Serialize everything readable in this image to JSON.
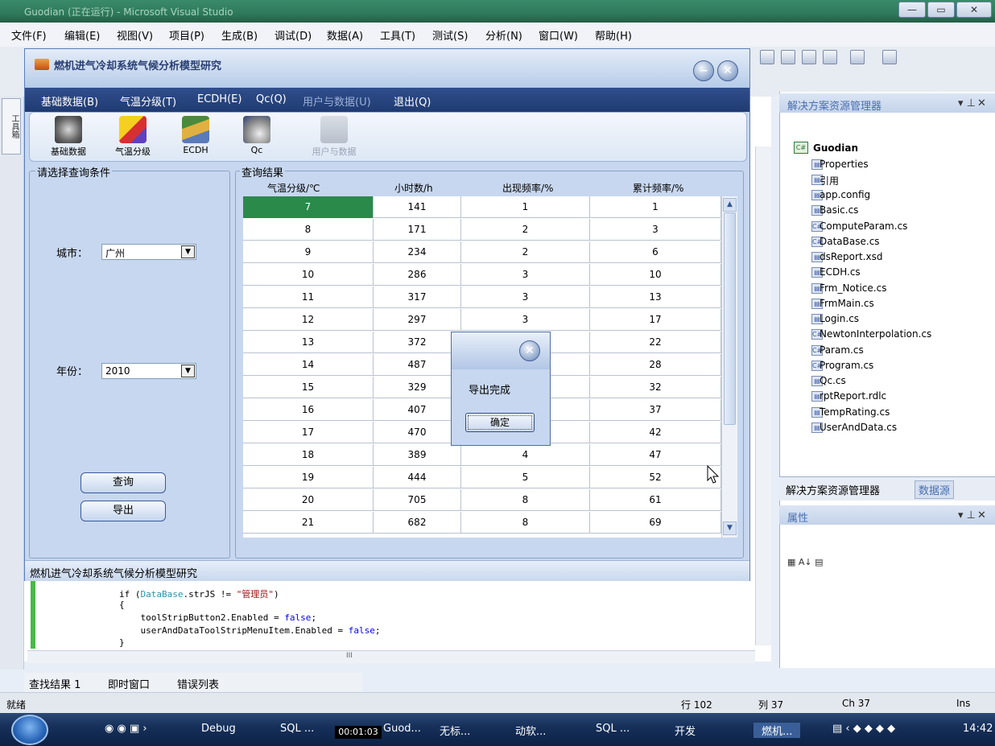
{
  "vs": {
    "window_title": "Guodian (正在运行) - Microsoft Visual Studio",
    "menu": [
      "文件(F)",
      "编辑(E)",
      "视图(V)",
      "项目(P)",
      "生成(B)",
      "调试(D)",
      "数据(A)",
      "工具(T)",
      "测试(S)",
      "分析(N)",
      "窗口(W)",
      "帮助(H)"
    ],
    "toolbox_tab": "工具箱",
    "code_lines": [
      {
        "pre": "if (",
        "type": "DataBase",
        "mid": ".strJS != ",
        "str": "\"管理员\"",
        "post": ")"
      },
      {
        "text": "{"
      },
      {
        "text": "    toolStripButton2.Enabled = ",
        "kw": "false",
        "post": ";"
      },
      {
        "text": "    userAndDataToolStripMenuItem.Enabled = ",
        "kw": "false",
        "post": ";"
      },
      {
        "text": "}"
      }
    ],
    "scroll_label": "III",
    "bottom_tabs": [
      "查找结果 1",
      "即时窗口",
      "错误列表"
    ],
    "status": {
      "ready": "就绪",
      "line": "行 102",
      "col": "列 37",
      "ch": "Ch 37",
      "ins": "Ins"
    }
  },
  "solution": {
    "title": "解决方案资源管理器",
    "project": "Guodian",
    "items": [
      "Properties",
      "引用",
      "app.config",
      "Basic.cs",
      "ComputeParam.cs",
      "DataBase.cs",
      "dsReport.xsd",
      "ECDH.cs",
      "Frm_Notice.cs",
      "FrmMain.cs",
      "Login.cs",
      "NewtonInterpolation.cs",
      "Param.cs",
      "Program.cs",
      "Qc.cs",
      "rptReport.rdlc",
      "TempRating.cs",
      "UserAndData.cs"
    ],
    "tab_solution": "解决方案资源管理器",
    "tab_datasource": "数据源",
    "properties_title": "属性"
  },
  "app": {
    "title": "燃机进气冷却系统气候分析模型研究",
    "menu": [
      "基础数据(B)",
      "气温分级(T)",
      "ECDH(E)",
      "Qc(Q)",
      "用户与数据(U)",
      "退出(Q)"
    ],
    "tools": [
      "基础数据",
      "气温分级",
      "ECDH",
      "Qc",
      "用户与数据"
    ],
    "query_group": "请选择查询条件",
    "city_label": "城市：",
    "city_value": "广州",
    "year_label": "年份：",
    "year_value": "2010",
    "query_button": "查询",
    "export_button": "导出",
    "result_group": "查询结果",
    "columns": [
      "气温分级/℃",
      "小时数/h",
      "出现频率/%",
      "累计频率/%"
    ],
    "rows": [
      [
        "7",
        "141",
        "1",
        "1"
      ],
      [
        "8",
        "171",
        "2",
        "3"
      ],
      [
        "9",
        "234",
        "2",
        "6"
      ],
      [
        "10",
        "286",
        "3",
        "10"
      ],
      [
        "11",
        "317",
        "3",
        "13"
      ],
      [
        "12",
        "297",
        "3",
        "17"
      ],
      [
        "13",
        "372",
        "",
        "22"
      ],
      [
        "14",
        "487",
        "",
        "28"
      ],
      [
        "15",
        "329",
        "",
        "32"
      ],
      [
        "16",
        "407",
        "",
        "37"
      ],
      [
        "17",
        "470",
        "",
        "42"
      ],
      [
        "18",
        "389",
        "4",
        "47"
      ],
      [
        "19",
        "444",
        "5",
        "52"
      ],
      [
        "20",
        "705",
        "8",
        "61"
      ],
      [
        "21",
        "682",
        "8",
        "69"
      ]
    ],
    "status_text": "燃机进气冷却系统气候分析模型研究"
  },
  "dialog": {
    "message": "导出完成",
    "ok": "确定"
  },
  "taskbar": {
    "items": [
      "Debug",
      "SQL ...",
      "Guod...",
      "无标...",
      "动软...",
      "SQL ...",
      "开发",
      "燃机..."
    ],
    "timer": "00:01:03",
    "clock": "14:42"
  },
  "colors": {
    "app_menu_bg": "#203b72",
    "selected_cell": "#2a8a4a",
    "editor_gutter": "#48b848"
  }
}
